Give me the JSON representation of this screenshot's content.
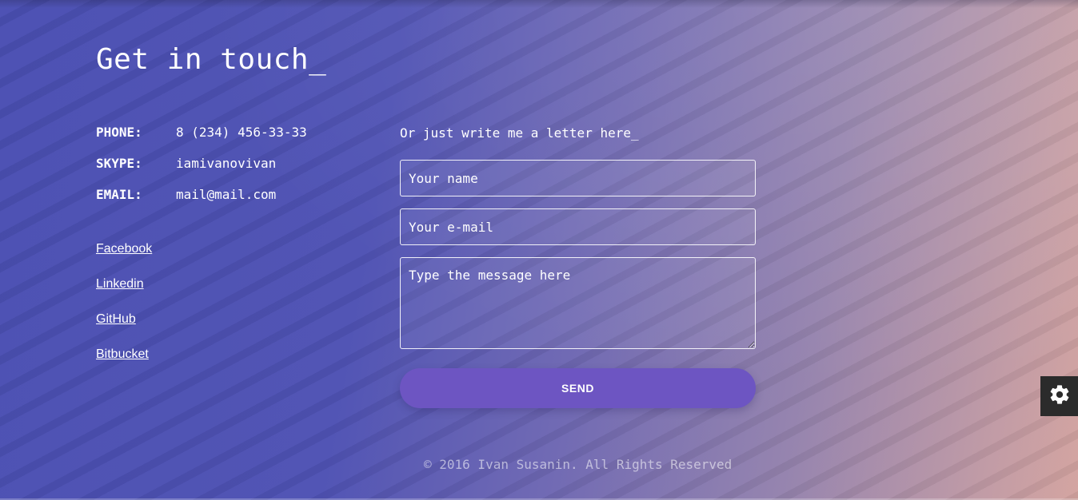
{
  "page": {
    "title": "Get in touch_"
  },
  "contacts": [
    {
      "label": "PHONE:",
      "value": "8 (234) 456-33-33"
    },
    {
      "label": "SKYPE:",
      "value": "iamivanovivan"
    },
    {
      "label": "EMAIL:",
      "value": "mail@mail.com"
    }
  ],
  "social_links": [
    {
      "label": "Facebook"
    },
    {
      "label": "Linkedin"
    },
    {
      "label": "GitHub"
    },
    {
      "label": "Bitbucket"
    }
  ],
  "form": {
    "intro": "Or just write me a letter here_",
    "name_placeholder": "Your name",
    "name_value": "",
    "email_placeholder": "Your e-mail",
    "email_value": "",
    "message_placeholder": "Type the message here",
    "message_value": "",
    "send_label": "SEND"
  },
  "footer": {
    "text": "© 2016 Ivan Susanin. All Rights Reserved"
  },
  "icons": {
    "settings": "gear-icon"
  },
  "colors": {
    "gradient_start": "#4a4fb2",
    "gradient_end": "#d3a39f",
    "send_button": "#6d55c2",
    "settings_button": "#2b2b2b"
  }
}
